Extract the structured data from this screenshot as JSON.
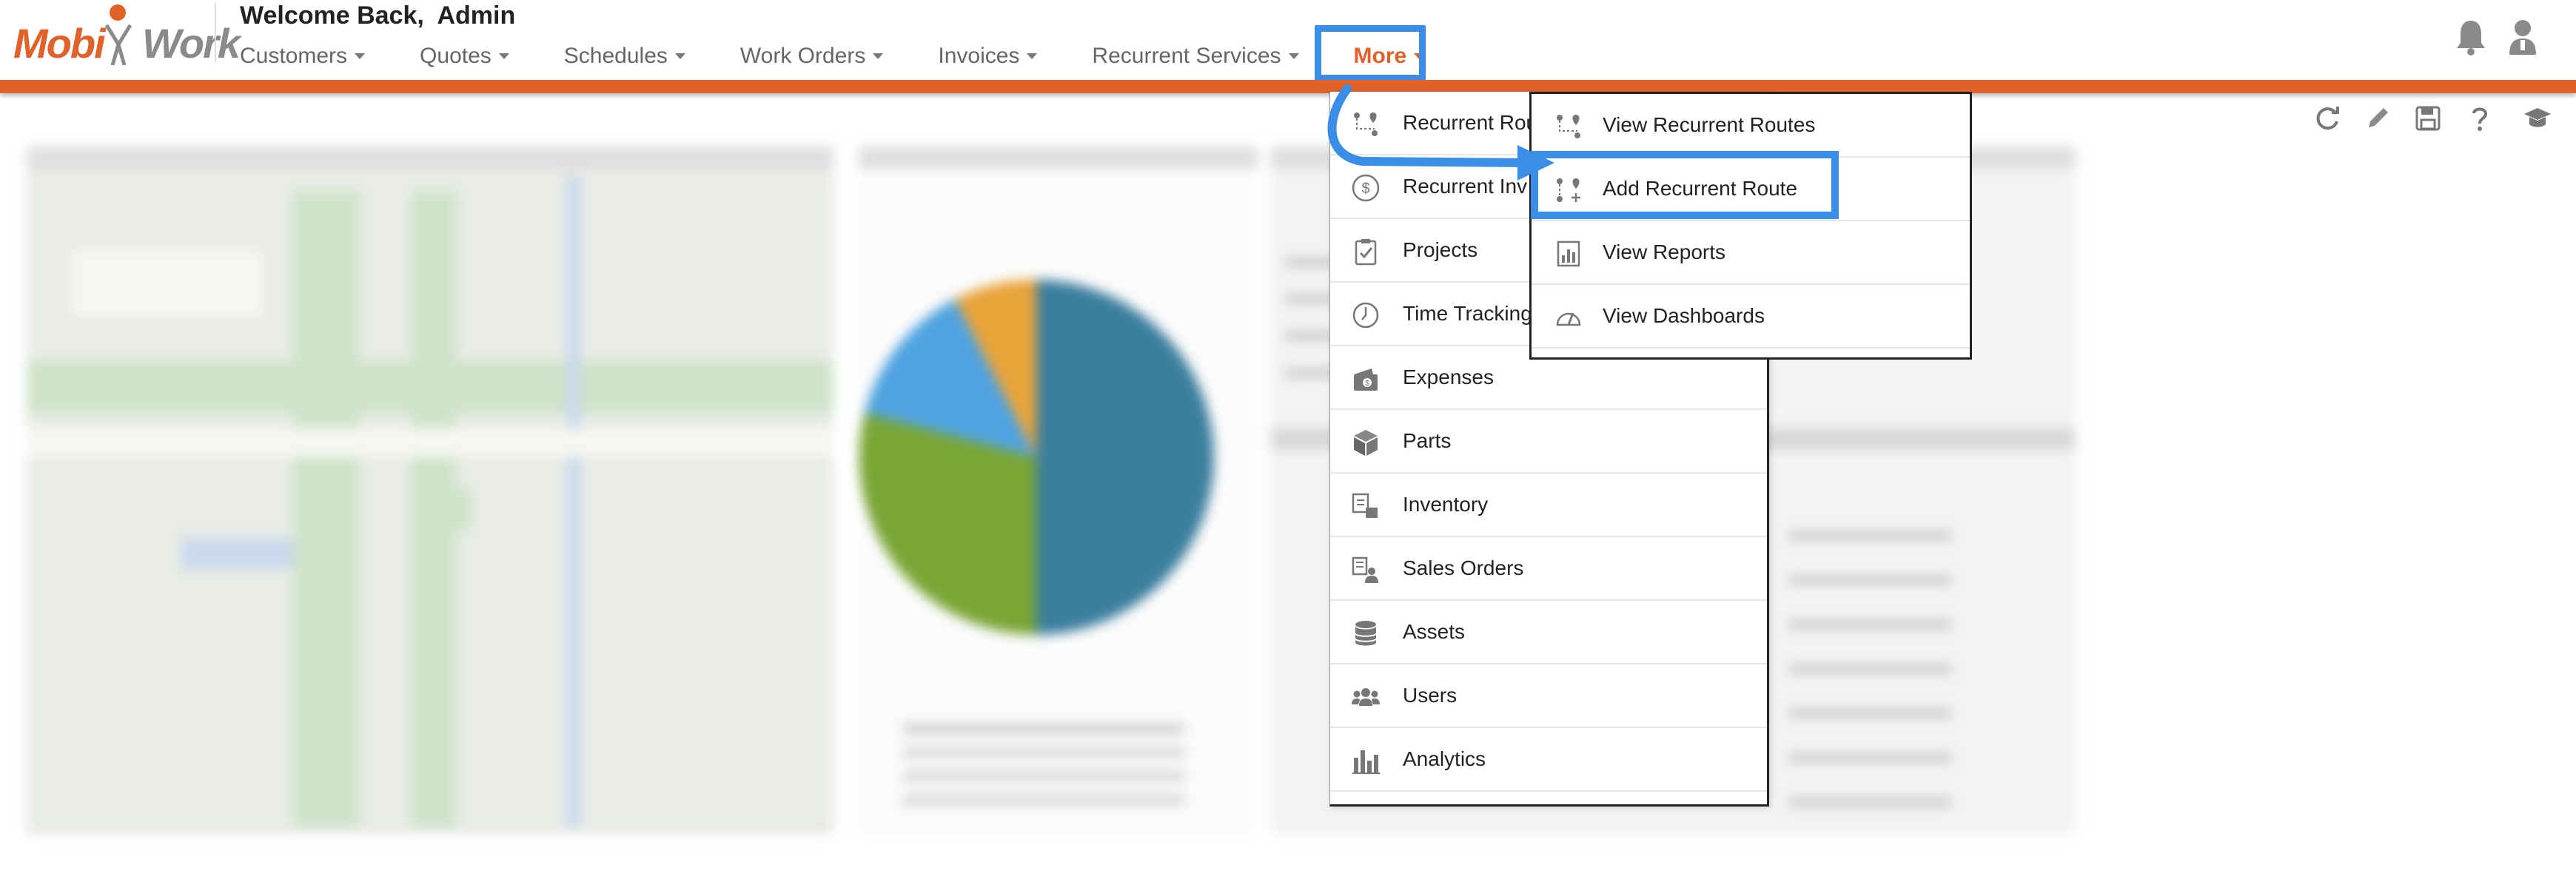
{
  "header": {
    "logo": {
      "part1": "Mobi",
      "part2": "Work"
    },
    "welcome": "Welcome Back,  Admin",
    "nav": [
      {
        "label": "Customers"
      },
      {
        "label": "Quotes"
      },
      {
        "label": "Schedules"
      },
      {
        "label": "Work Orders"
      },
      {
        "label": "Invoices"
      },
      {
        "label": "Recurrent Services"
      },
      {
        "label": "More"
      }
    ],
    "icons": [
      "bell-icon",
      "user-icon"
    ]
  },
  "toolbar": {
    "icons": [
      "refresh-icon",
      "pencil-icon",
      "save-icon",
      "help-icon",
      "graduation-cap-icon"
    ]
  },
  "menu": {
    "items": [
      {
        "label": "Recurrent Rou",
        "icon": "route-icon"
      },
      {
        "label": "Recurrent Inv",
        "icon": "dollar-circle-icon"
      },
      {
        "label": "Projects",
        "icon": "clipboard-check-icon"
      },
      {
        "label": "Time Tracking",
        "icon": "clock-icon"
      },
      {
        "label": "Expenses",
        "icon": "wallet-icon"
      },
      {
        "label": "Parts",
        "icon": "cube-icon"
      },
      {
        "label": "Inventory",
        "icon": "inventory-icon"
      },
      {
        "label": "Sales Orders",
        "icon": "sales-order-icon"
      },
      {
        "label": "Assets",
        "icon": "database-icon"
      },
      {
        "label": "Users",
        "icon": "users-icon"
      },
      {
        "label": "Analytics",
        "icon": "bar-chart-icon"
      }
    ]
  },
  "submenu": {
    "items": [
      {
        "label": "View Recurrent Routes",
        "icon": "route-icon"
      },
      {
        "label": "Add Recurrent Route",
        "icon": "route-add-icon"
      },
      {
        "label": "View Reports",
        "icon": "report-icon"
      },
      {
        "label": "View Dashboards",
        "icon": "gauge-icon"
      }
    ]
  },
  "colors": {
    "brand": "#e0612a",
    "highlight": "#3a8ee8",
    "logo_gray": "#8a8a8a"
  }
}
